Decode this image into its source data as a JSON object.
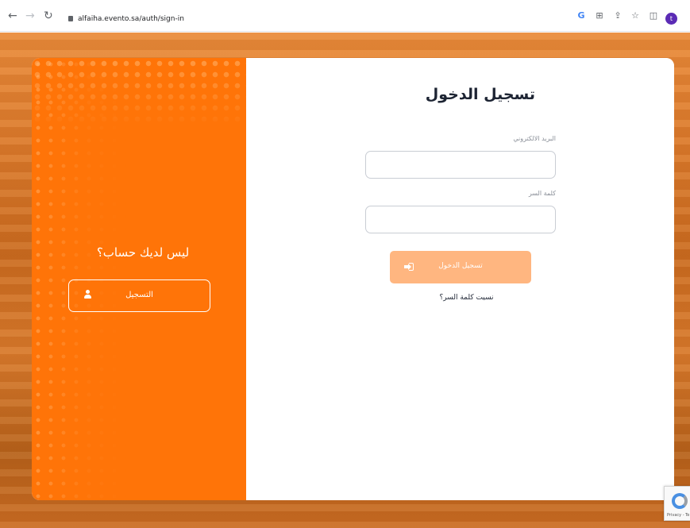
{
  "browser": {
    "url": "alfaiha.evento.sa/auth/sign-in",
    "profile_initial": "t"
  },
  "register_panel": {
    "question": "ليس لديك حساب؟",
    "register_label": "التسجيل"
  },
  "login_form": {
    "title": "تسجيل الدخول",
    "email_label": "البريد الالكتروني",
    "email_value": "",
    "password_label": "كلمة السر",
    "password_value": "",
    "submit_label": "تسجيل الدخول",
    "forgot_password": "نسيت كلمة السر؟"
  },
  "recaptcha": {
    "text": "Privacy - Te"
  },
  "colors": {
    "accent": "#ff7408",
    "button_disabled": "#ffb680",
    "title": "#1d2433"
  },
  "icons": {
    "register": "user-icon",
    "submit": "sign-in-icon"
  }
}
